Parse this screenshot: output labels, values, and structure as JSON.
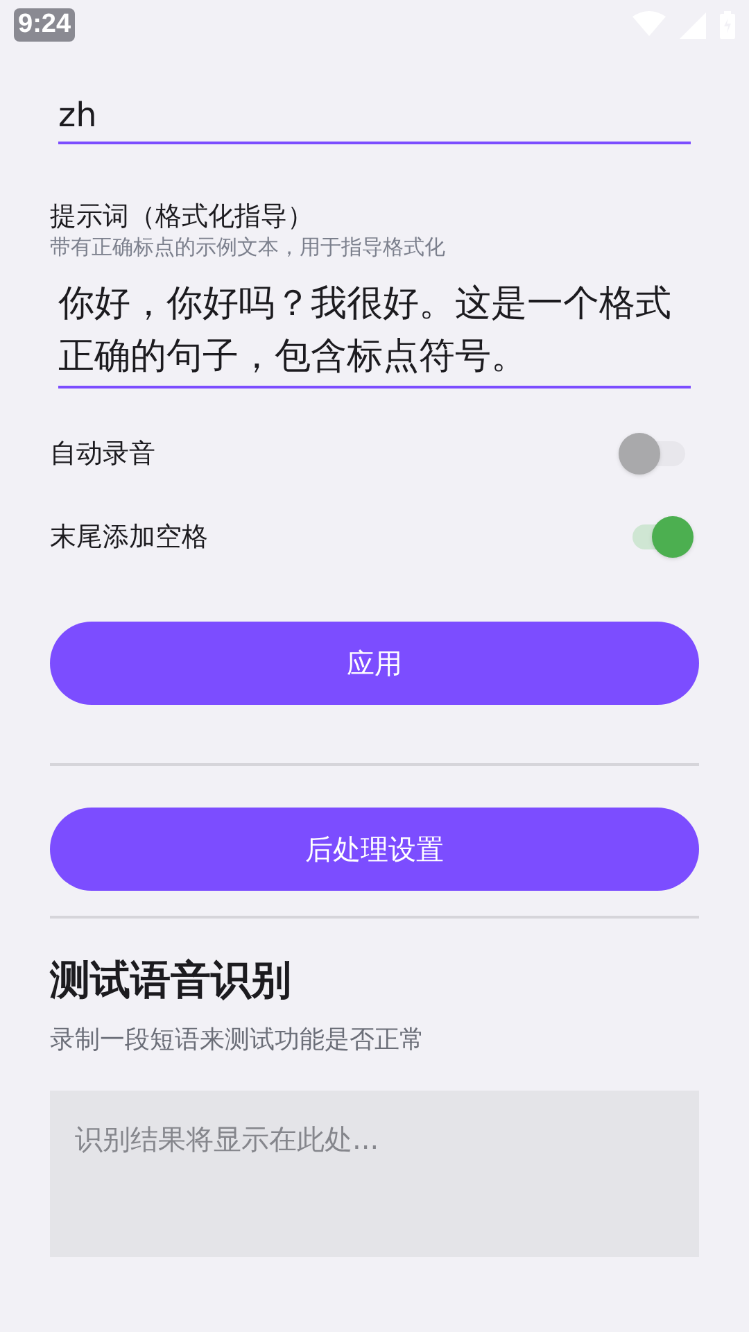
{
  "status_bar": {
    "time": "9:24"
  },
  "language_field": {
    "value": "zh"
  },
  "prompt": {
    "label": "提示词（格式化指导）",
    "hint": "带有正确标点的示例文本，用于指导格式化",
    "value": "你好，你好吗？我很好。这是一个格式正确的句子，包含标点符号。"
  },
  "toggles": [
    {
      "label": "自动录音",
      "on": false
    },
    {
      "label": "末尾添加空格",
      "on": true
    }
  ],
  "apply_button": "应用",
  "postprocess_button": "后处理设置",
  "test": {
    "title": "测试语音识别",
    "subtitle": "录制一段短语来测试功能是否正常",
    "result": {
      "placeholder": "识别结果将显示在此处..."
    }
  }
}
